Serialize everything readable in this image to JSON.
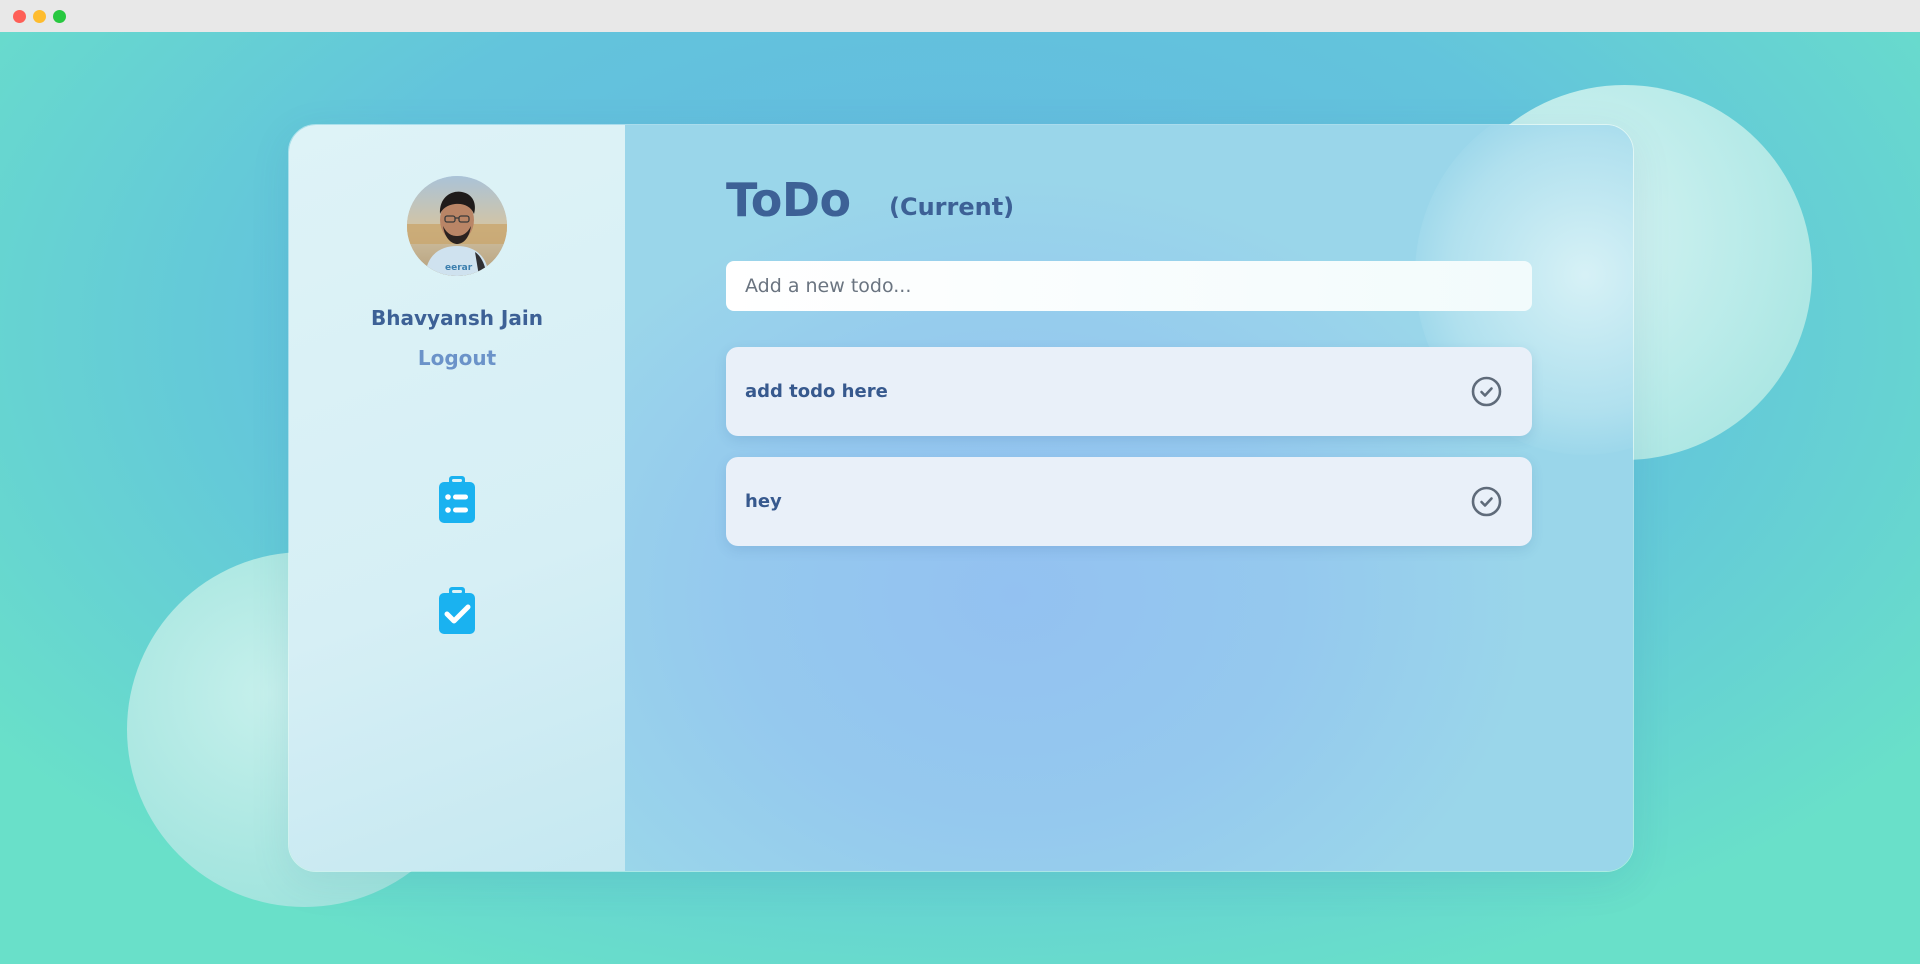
{
  "user": {
    "name": "Bhavyansh Jain",
    "logout_label": "Logout"
  },
  "nav": [
    {
      "icon": "clipboard-list-icon"
    },
    {
      "icon": "clipboard-check-icon"
    }
  ],
  "main": {
    "title": "ToDo",
    "subtitle": "(Current)",
    "input_placeholder": "Add a new todo..."
  },
  "todos": [
    {
      "text": "add todo here",
      "icon": "check-circle-icon"
    },
    {
      "text": "hey",
      "icon": "check-circle-icon"
    }
  ],
  "colors": {
    "accent_text": "#3d6196",
    "logout": "#6b93c9",
    "nav_icon": "#1ab2f0",
    "check_icon": "#5f6b7a"
  }
}
